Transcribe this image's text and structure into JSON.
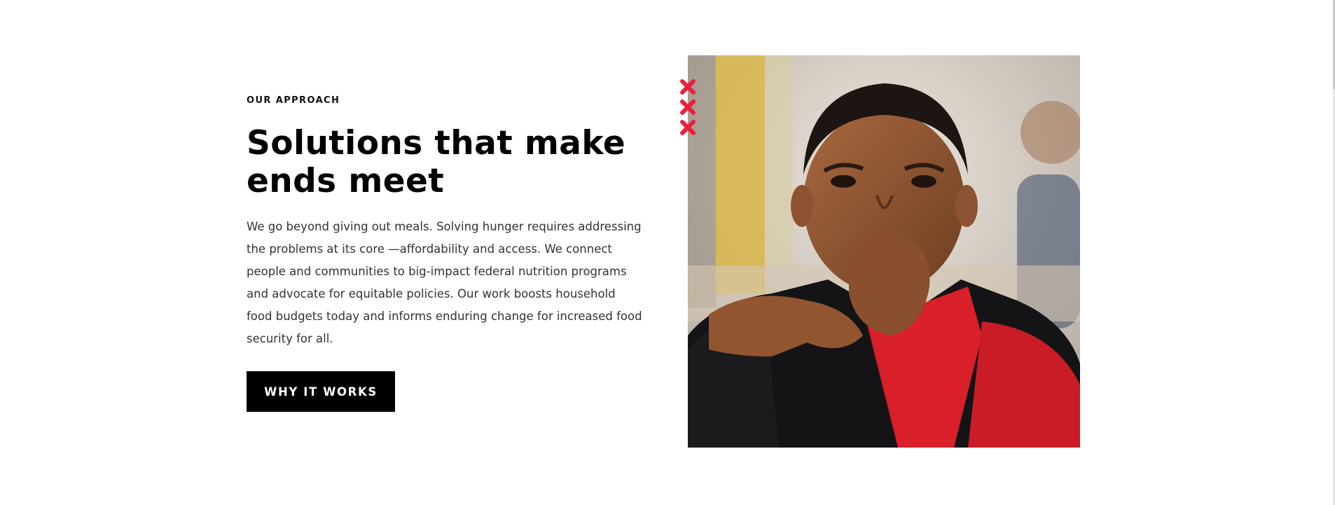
{
  "section": {
    "eyebrow": "OUR APPROACH",
    "headline": "Solutions that make ends meet",
    "body": "We go beyond giving out meals. Solving hunger requires addressing the problems at its core —affordability and access. We connect people and communities to big-impact federal nutrition programs and advocate for equitable policies. Our work boosts household food budgets today and informs enduring change for increased food security for all.",
    "cta_label": "WHY IT WORKS"
  },
  "colors": {
    "accent": "#ef1d3b",
    "button_bg": "#000000",
    "text": "#000000"
  },
  "icons": [
    "x-mark-icon",
    "x-mark-icon",
    "x-mark-icon"
  ]
}
